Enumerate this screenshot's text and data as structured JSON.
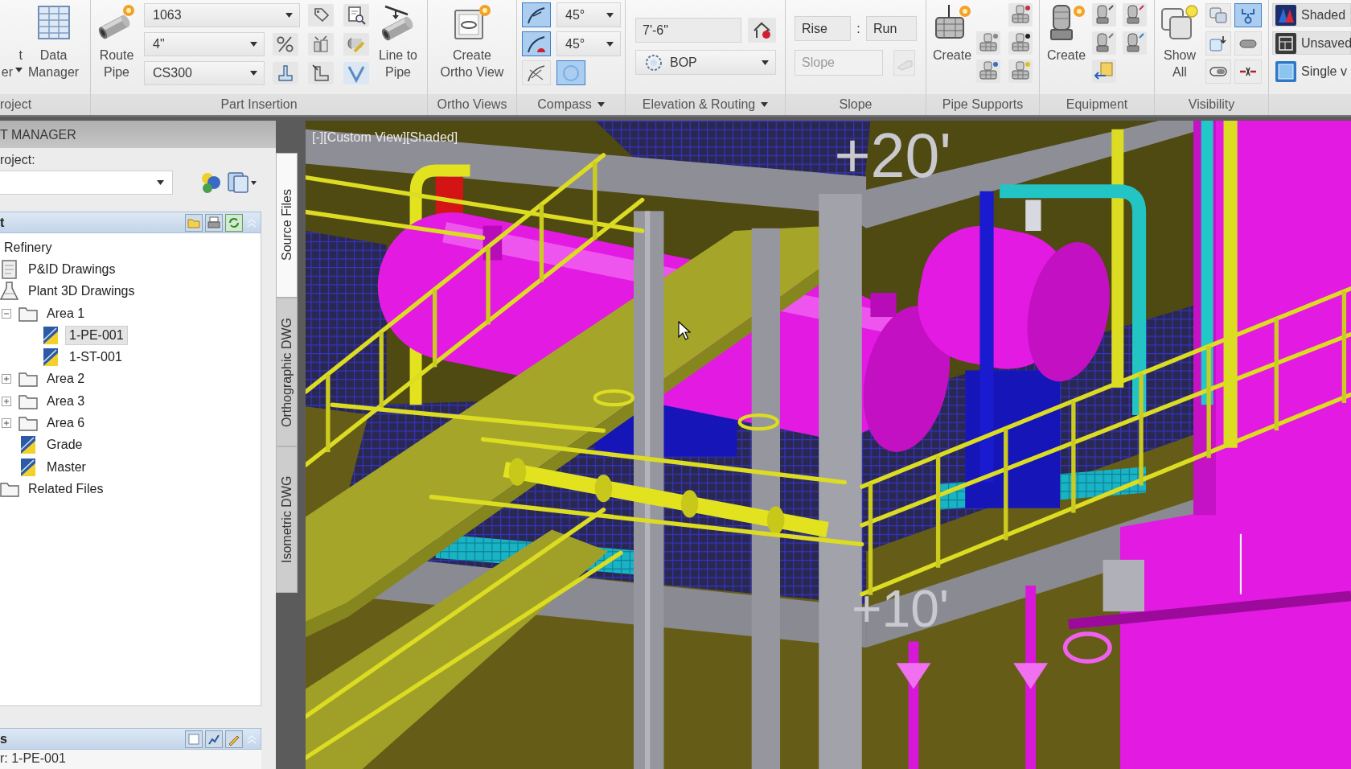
{
  "ribbon": {
    "panels": [
      {
        "kind": "project",
        "title": "roject",
        "menu": false,
        "buttons": [
          {
            "lines": [
              "t",
              "er"
            ],
            "menu": true
          },
          {
            "lines": [
              "Data",
              "Manager"
            ],
            "menu": false
          }
        ]
      },
      {
        "kind": "insertion",
        "title": "Part Insertion",
        "menu": false,
        "buttons": [
          {
            "lines": [
              "Route",
              "Pipe"
            ],
            "menu": false
          },
          {
            "lines": [
              "Line to",
              "Pipe"
            ],
            "menu": false
          }
        ],
        "dropdowns": [
          {
            "value": "1063"
          },
          {
            "value": "4\""
          },
          {
            "value": "CS300"
          }
        ]
      },
      {
        "kind": "ortho",
        "title": "Ortho Views",
        "menu": false,
        "buttons": [
          {
            "lines": [
              "Create",
              "Ortho View"
            ],
            "menu": false
          }
        ]
      },
      {
        "kind": "compass",
        "title": "Compass",
        "menu": true,
        "toggles": [
          {
            "selected": true
          },
          {
            "selected": true
          },
          {
            "selected": false
          },
          {
            "selected": true
          }
        ],
        "dropdowns": [
          {
            "value": "45°"
          },
          {
            "value": "45°"
          }
        ]
      },
      {
        "kind": "elevation",
        "title": "Elevation & Routing",
        "menu": true,
        "fields": [
          {
            "value": "7'-6\""
          }
        ],
        "dropdowns": [
          {
            "value": "BOP"
          }
        ]
      },
      {
        "kind": "slope",
        "title": "Slope",
        "menu": false,
        "fields": [
          {
            "value": "Rise",
            "disabled": false
          },
          {
            "value": "Run",
            "disabled": false
          },
          {
            "value": "Slope",
            "disabled": true
          }
        ],
        "separator": ":",
        "button": {
          "disabled": true
        }
      },
      {
        "kind": "supports",
        "title": "Pipe Supports",
        "menu": false,
        "buttons": [
          {
            "lines": [
              "Create"
            ],
            "menu": false
          }
        ]
      },
      {
        "kind": "equipment",
        "title": "Equipment",
        "menu": false,
        "buttons": [
          {
            "lines": [
              "Create"
            ],
            "menu": false
          }
        ]
      },
      {
        "kind": "visibility",
        "title": "Visibility",
        "menu": false,
        "buttons": [
          {
            "lines": [
              "Show",
              "All"
            ],
            "menu": false
          }
        ],
        "toggles": [
          {
            "selected": false
          },
          {
            "selected": true
          },
          {
            "selected": false
          },
          {
            "selected": false
          },
          {
            "selected": false
          },
          {
            "selected": false
          }
        ]
      },
      {
        "kind": "view",
        "items": [
          {
            "kind": "dropdown",
            "label": "Shaded"
          },
          {
            "kind": "dropdown",
            "label": "Unsaved"
          },
          {
            "kind": "button",
            "label": "Single v"
          }
        ]
      }
    ]
  },
  "project_manager": {
    "title": "T MANAGER",
    "project_label": "roject:",
    "tree_header": "t",
    "tree": [
      {
        "label": "Refinery",
        "selected": false,
        "children": [
          {
            "label": "P&ID Drawings",
            "kind": "pid",
            "selected": false
          },
          {
            "label": "Plant 3D Drawings",
            "kind": "plant",
            "selected": false,
            "children": [
              {
                "label": "Area 1",
                "kind": "folder",
                "expanded": true,
                "selected": false,
                "children": [
                  {
                    "label": "1-PE-001",
                    "kind": "drawing",
                    "selected": true
                  },
                  {
                    "label": "1-ST-001",
                    "kind": "drawing",
                    "selected": false
                  }
                ]
              },
              {
                "label": "Area 2",
                "kind": "folder",
                "expanded": false,
                "selected": false
              },
              {
                "label": "Area 3",
                "kind": "folder",
                "expanded": false,
                "selected": false
              },
              {
                "label": "Area 6",
                "kind": "folder",
                "expanded": false,
                "selected": false
              },
              {
                "label": "Grade",
                "kind": "drawing",
                "selected": false
              },
              {
                "label": "Master",
                "kind": "drawing",
                "selected": false
              }
            ]
          },
          {
            "label": "Related Files",
            "kind": "folder",
            "selected": false
          }
        ]
      }
    ],
    "details_header": "s",
    "details_text": "r: 1-PE-001",
    "tabs": [
      {
        "label": "Source Files",
        "selected": true
      },
      {
        "label": "Orthographic DWG",
        "selected": false
      },
      {
        "label": "Isometric DWG",
        "selected": false
      }
    ]
  },
  "viewport": {
    "label": "[-][Custom View][Shaded]",
    "elevation_labels": [
      "+20'",
      "+10'"
    ]
  }
}
